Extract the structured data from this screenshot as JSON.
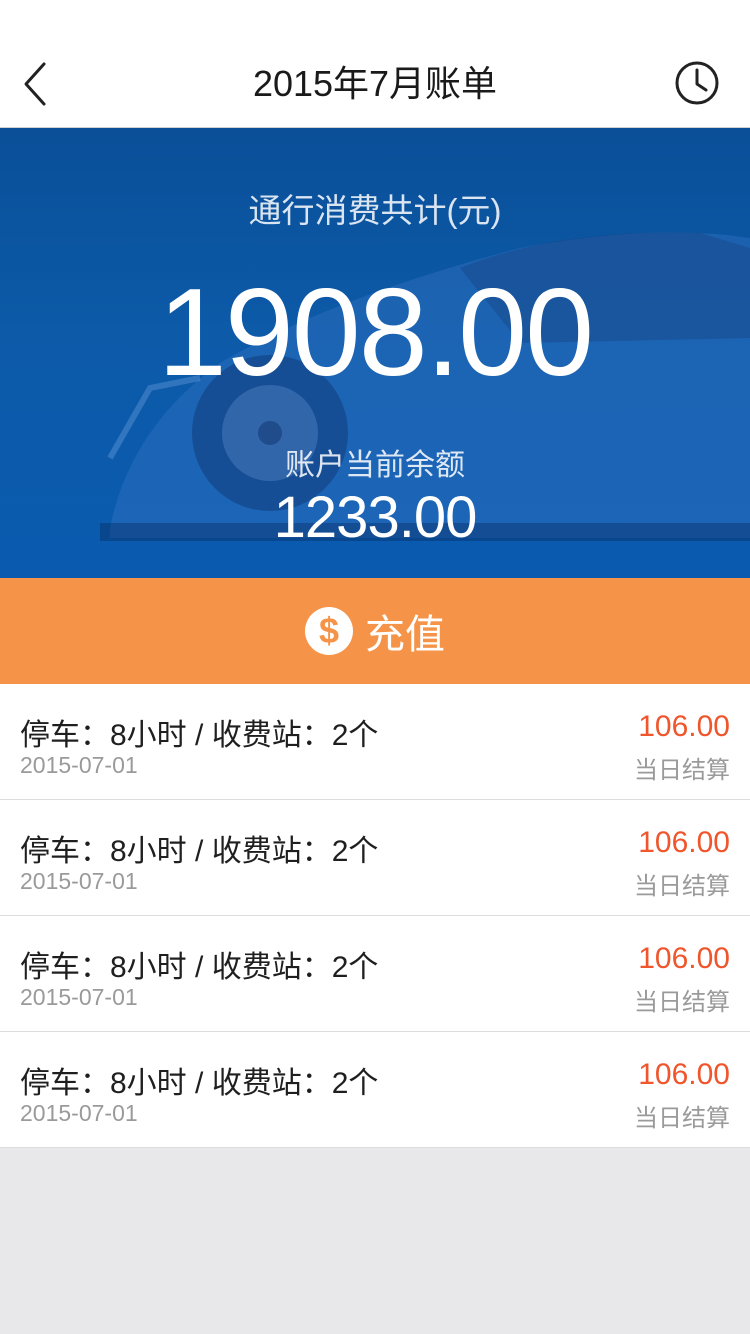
{
  "nav": {
    "title": "2015年7月账单",
    "back_icon": "chevron-left-icon",
    "history_icon": "clock-icon"
  },
  "summary": {
    "label": "通行消费共计(元)",
    "total": "1908.00",
    "balance_label": "账户当前余额",
    "balance": "1233.00"
  },
  "recharge": {
    "label": "充值",
    "icon": "$",
    "color": "#f59449"
  },
  "records": [
    {
      "title": "停车：8小时 / 收费站：2个",
      "date": "2015-07-01",
      "amount": "106.00",
      "note": "当日结算"
    },
    {
      "title": "停车：8小时 / 收费站：2个",
      "date": "2015-07-01",
      "amount": "106.00",
      "note": "当日结算"
    },
    {
      "title": "停车：8小时 / 收费站：2个",
      "date": "2015-07-01",
      "amount": "106.00",
      "note": "当日结算"
    },
    {
      "title": "停车：8小时 / 收费站：2个",
      "date": "2015-07-01",
      "amount": "106.00",
      "note": "当日结算"
    }
  ],
  "colors": {
    "hero": "#0a5bb0",
    "amount": "#f0552b"
  }
}
